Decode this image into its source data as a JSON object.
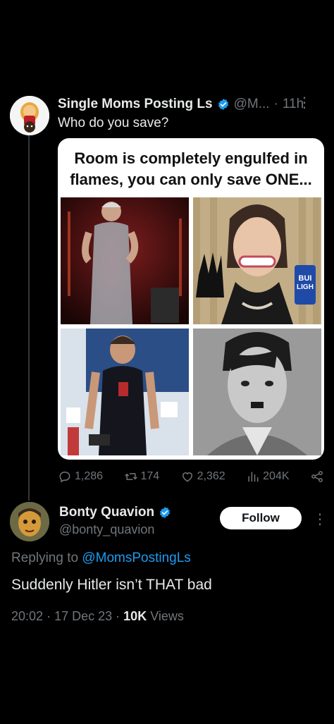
{
  "tweet": {
    "author_name": "Single Moms Posting Ls",
    "author_handle": "@M...",
    "time": "11h",
    "separator": "·",
    "text": "Who do you save?",
    "media": {
      "title_line1": "Room is completely engulfed in",
      "title_line2": "flames, you can only save ONE...",
      "can_label_1": "BUI",
      "can_label_2": "LIGH"
    },
    "stats": {
      "replies": "1,286",
      "reposts": "174",
      "likes": "2,362",
      "views": "204K"
    }
  },
  "reply": {
    "author_name": "Bonty Quavion",
    "author_handle": "@bonty_quavion",
    "follow_label": "Follow",
    "replying_prefix": "Replying to ",
    "replying_mention": "@MomsPostingLs",
    "text": "Suddenly Hitler isn’t THAT bad",
    "time": "20:02",
    "date": "17 Dec 23",
    "views_count": "10K",
    "views_label": "Views",
    "dot": "·"
  },
  "colors": {
    "background": "#000000",
    "text_primary": "#e7e9ea",
    "text_secondary": "#71767b",
    "accent": "#1d9bf0",
    "verified_badge": "#1d9bf0"
  },
  "icons": [
    "emoji-avatar-icon",
    "verified-badge-icon",
    "more-icon",
    "reply-icon",
    "repost-icon",
    "like-icon",
    "views-icon",
    "share-icon"
  ]
}
